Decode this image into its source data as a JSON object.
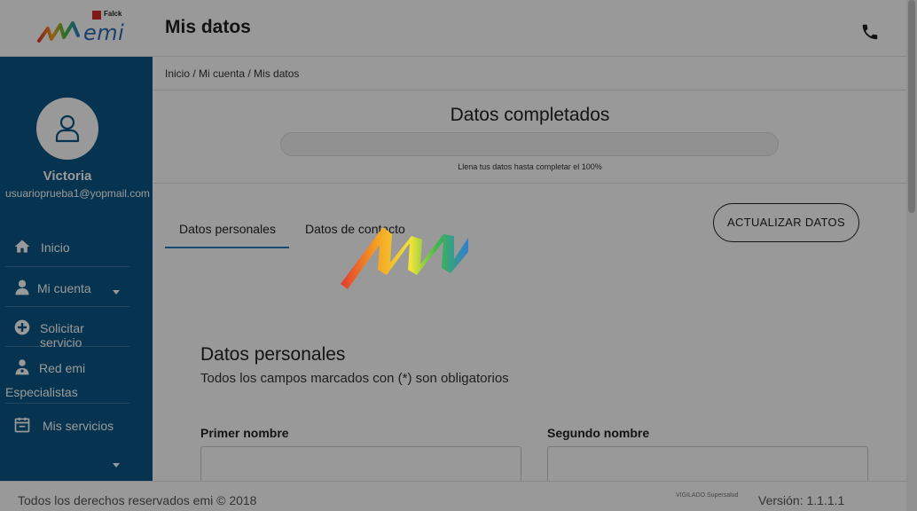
{
  "header": {
    "logo_brand": "Falck",
    "logo_name": "emi",
    "page_title": "Mis datos",
    "phone_icon": "phone-icon"
  },
  "sidebar": {
    "avatar_icon": "user-icon",
    "user_name": "Victoria",
    "user_email": "usuarioprueba1@yopmail.com",
    "items": [
      {
        "label": "Inicio",
        "icon": "home-icon"
      },
      {
        "label": "Mi cuenta",
        "icon": "person-icon"
      },
      {
        "label": "Solicitar servicio",
        "icon": "plus-circle-icon"
      },
      {
        "label": "Red emi",
        "label2": "Especialistas",
        "icon": "doctor-icon"
      },
      {
        "label": "Mis servicios",
        "icon": "calendar-icon"
      }
    ]
  },
  "breadcrumb": "Inicio / Mi cuenta / Mis datos",
  "progress": {
    "title": "Datos completados",
    "hint": "Llena tus datos hasta completar el 100%",
    "value": 0
  },
  "tabs": [
    "Datos personales",
    "Datos de contacto"
  ],
  "actions": {
    "update_label": "ACTUALIZAR DATOS"
  },
  "section": {
    "title": "Datos personales",
    "subtitle": "Todos los campos marcados con (*) son obligatorios"
  },
  "fields": {
    "first_name_label": "Primer nombre",
    "first_name_value": "",
    "second_name_label": "Segundo nombre",
    "second_name_value": ""
  },
  "footer": {
    "copyright": "Todos los derechos reservados emi © 2018",
    "supervisor_text": "VIGILADO Supersalud",
    "version": "Versión: 1.1.1.1"
  },
  "colors": {
    "sidebar_bg": "#0b5785",
    "accent": "#2b7bb9",
    "overlay": "rgba(0,0,0,0.4)"
  },
  "loader_icon": "emi-loading-icon"
}
